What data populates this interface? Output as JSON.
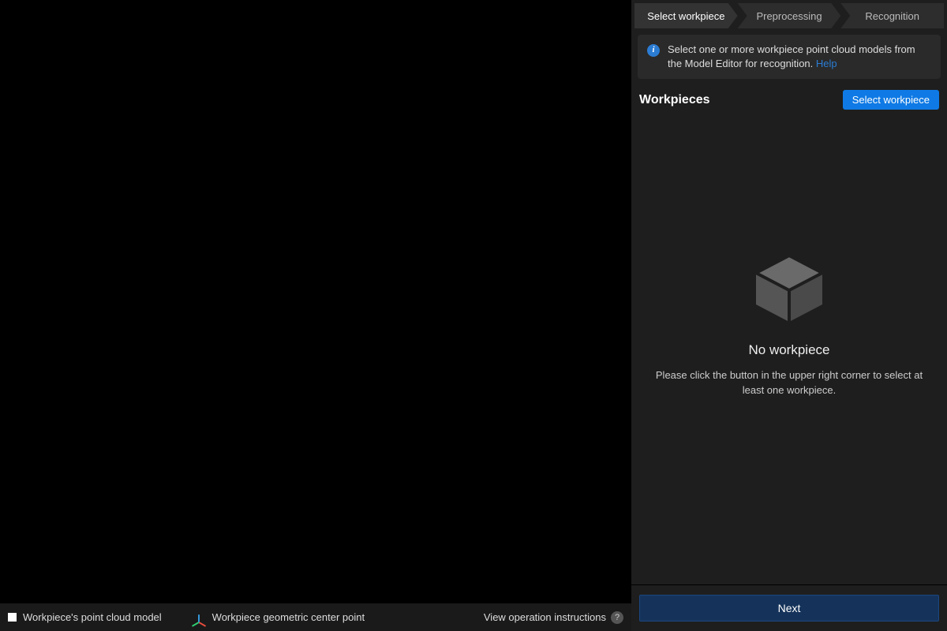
{
  "stepper": {
    "step1": "Select workpiece",
    "step2": "Preprocessing",
    "step3": "Recognition"
  },
  "info": {
    "text": "Select one or more workpiece point cloud models from the Model Editor for recognition. ",
    "help_label": "Help"
  },
  "section": {
    "title": "Workpieces",
    "select_button": "Select workpiece"
  },
  "empty": {
    "title": "No workpiece",
    "description": "Please click the button in the upper right corner to select at least one workpiece."
  },
  "footer": {
    "next_label": "Next"
  },
  "viewport_legend": {
    "point_cloud": "Workpiece's point cloud model",
    "geom_center": "Workpiece geometric center point",
    "view_ops": "View operation instructions"
  }
}
